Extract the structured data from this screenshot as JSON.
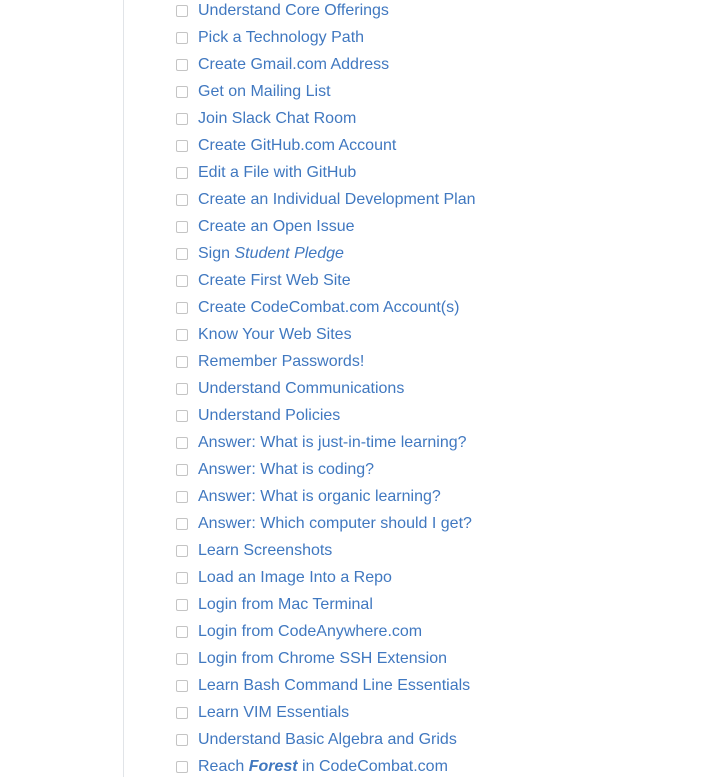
{
  "checklist": {
    "items": [
      {
        "label": "Understand Core Offerings",
        "checked": false
      },
      {
        "label": "Pick a Technology Path",
        "checked": false
      },
      {
        "label": "Create Gmail.com Address",
        "checked": false
      },
      {
        "label": "Get on Mailing List",
        "checked": false
      },
      {
        "label": "Join Slack Chat Room",
        "checked": false
      },
      {
        "label": "Create GitHub.com Account",
        "checked": false
      },
      {
        "label": "Edit a File with GitHub",
        "checked": false
      },
      {
        "label": "Create an Individual Development Plan",
        "checked": false
      },
      {
        "label": "Create an Open Issue",
        "checked": false
      },
      {
        "label_prefix": "Sign ",
        "label_em": "Student Pledge",
        "checked": false
      },
      {
        "label": "Create First Web Site",
        "checked": false
      },
      {
        "label": "Create CodeCombat.com Account(s)",
        "checked": false
      },
      {
        "label": "Know Your Web Sites",
        "checked": false
      },
      {
        "label": "Remember Passwords!",
        "checked": false
      },
      {
        "label": "Understand Communications",
        "checked": false
      },
      {
        "label": "Understand Policies",
        "checked": false
      },
      {
        "label": "Answer: What is just-in-time learning?",
        "checked": false
      },
      {
        "label": "Answer: What is coding?",
        "checked": false
      },
      {
        "label": "Answer: What is organic learning?",
        "checked": false
      },
      {
        "label": "Answer: Which computer should I get?",
        "checked": false
      },
      {
        "label": "Learn Screenshots",
        "checked": false
      },
      {
        "label": "Load an Image Into a Repo",
        "checked": false
      },
      {
        "label": "Login from Mac Terminal",
        "checked": false
      },
      {
        "label": "Login from CodeAnywhere.com",
        "checked": false
      },
      {
        "label": "Login from Chrome SSH Extension",
        "checked": false
      },
      {
        "label": "Learn Bash Command Line Essentials",
        "checked": false
      },
      {
        "label": "Learn VIM Essentials",
        "checked": false
      },
      {
        "label": "Understand Basic Algebra and Grids",
        "checked": false
      },
      {
        "label_prefix": "Reach ",
        "label_strong": "Forest",
        "label_suffix": " in CodeCombat.com",
        "checked": false
      }
    ]
  },
  "colors": {
    "link": "#4078c0",
    "checkbox_border": "#c4c4c4",
    "rule": "#e1e4e8",
    "background": "#ffffff"
  }
}
